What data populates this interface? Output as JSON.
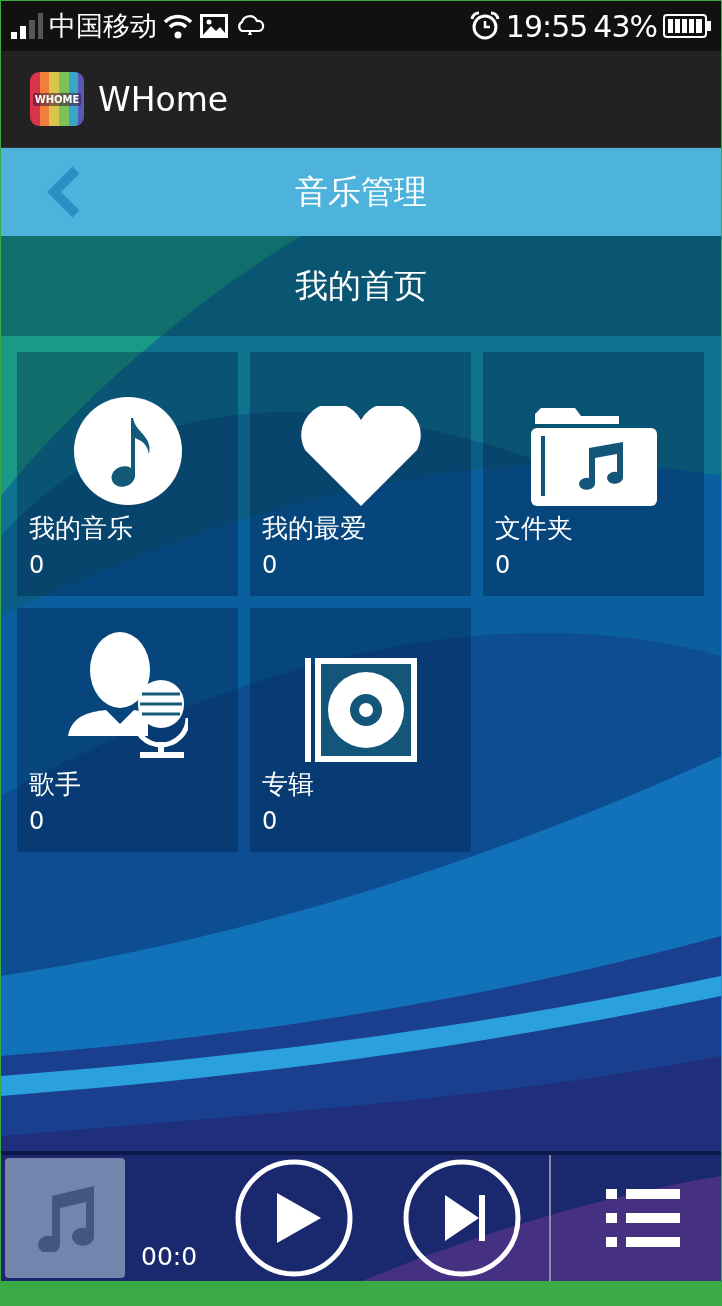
{
  "status_bar": {
    "carrier": "中国移动",
    "time": "19:55",
    "battery": "43%"
  },
  "app_bar": {
    "logo_text": "WHOME",
    "title": "WHome"
  },
  "header": {
    "title": "音乐管理"
  },
  "page_title": "我的首页",
  "tiles": [
    {
      "kind": "music",
      "label": "我的音乐",
      "count": "0"
    },
    {
      "kind": "favorite",
      "label": "我的最爱",
      "count": "0"
    },
    {
      "kind": "folder",
      "label": "文件夹",
      "count": "0"
    },
    {
      "kind": "artist",
      "label": "歌手",
      "count": "0"
    },
    {
      "kind": "album",
      "label": "专辑",
      "count": "0"
    }
  ],
  "player": {
    "time": "00:0"
  }
}
